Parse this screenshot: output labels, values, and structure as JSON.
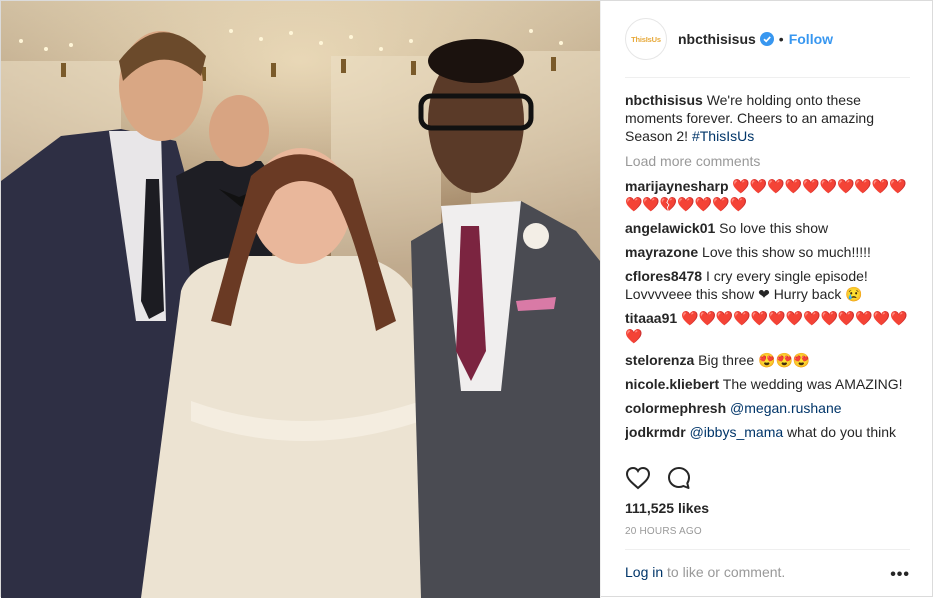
{
  "post": {
    "username": "nbcthisisus",
    "avatar_text": "ThisIsUs",
    "follow_label": "Follow",
    "separator": "•",
    "colors": {
      "follow": "#3897f0",
      "link": "#003569",
      "muted": "#999999",
      "heart": "#ed1c24"
    },
    "caption": {
      "user": "nbcthisisus",
      "text": "We're holding onto these moments forever. Cheers to an amazing Season 2!",
      "hashtag": "#ThisIsUs"
    },
    "load_more": "Load more comments",
    "comments": [
      {
        "user": "marijaynesharp",
        "text": "❤️❤️❤️❤️❤️❤️❤️❤️❤️❤️❤️❤️💔❤️❤️❤️❤️"
      },
      {
        "user": "angelawick01",
        "text": "So love this show"
      },
      {
        "user": "mayrazone",
        "text": "Love this show so much!!!!!"
      },
      {
        "user": "cflores8478",
        "text": "I cry every single episode! Lovvvveee this show ❤ Hurry back 😢"
      },
      {
        "user": "titaaa91",
        "text": "❤️❤️❤️❤️❤️❤️❤️❤️❤️❤️❤️❤️❤️❤️"
      },
      {
        "user": "stelorenza",
        "text": "Big three 😍😍😍"
      },
      {
        "user": "nicole.kliebert",
        "text": "The wedding was AMAZING!"
      },
      {
        "user": "colormephresh",
        "mention": "@megan.rushane",
        "text": ""
      },
      {
        "user": "jodkrmdr",
        "mention": "@ibbys_mama",
        "text": "what do you think"
      }
    ],
    "icons": {
      "like": "heart-outline-icon",
      "comment": "comment-bubble-icon",
      "verified": "verified-badge-icon",
      "more": "more-options-icon"
    },
    "likes": "111,525 likes",
    "timestamp": "20 HOURS AGO",
    "login_link": "Log in",
    "login_rest": " to like or comment.",
    "more_label": "•••"
  }
}
